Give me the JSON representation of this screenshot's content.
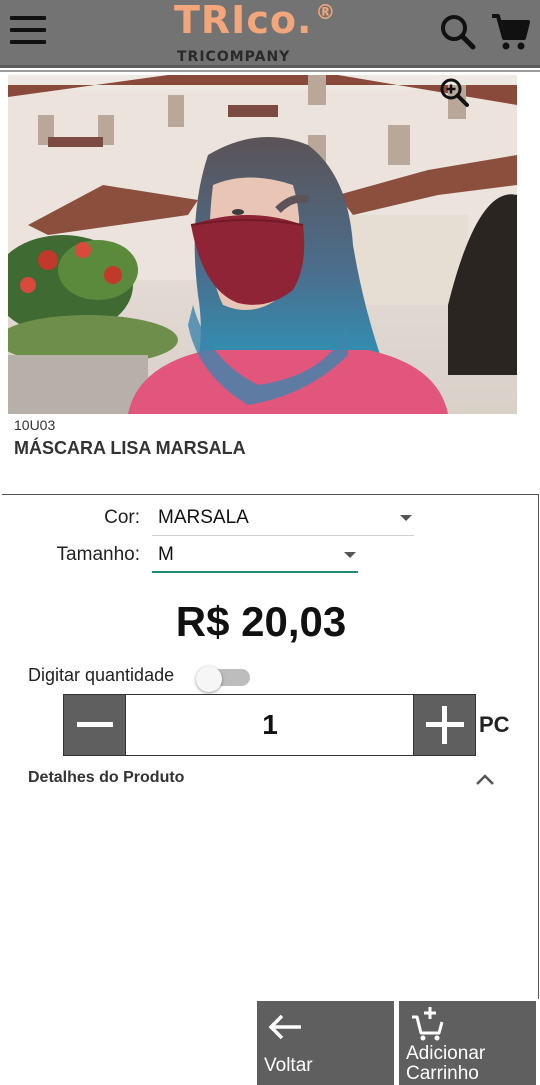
{
  "header": {
    "logo_text": "TRIco.",
    "logo_registered": "®",
    "logo_subtitle": "TRICOMPANY",
    "icons": [
      "menu-icon",
      "search-icon",
      "cart-icon"
    ]
  },
  "product": {
    "sku": "10U03",
    "name": "MÁSCARA LISA MARSALA",
    "zoom_icon": "zoom-in-icon"
  },
  "options": {
    "color_label": "Cor:",
    "color_value": "MARSALA",
    "size_label": "Tamanho:",
    "size_value": "M"
  },
  "price": "R$ 20,03",
  "quantity": {
    "toggle_label": "Digitar quantidade",
    "toggle_on": false,
    "value": "1",
    "unit": "PC"
  },
  "details": {
    "label": "Detalhes do Produto",
    "expanded": true
  },
  "actions": {
    "back_label": "Voltar",
    "add_label_line1": "Adicionar",
    "add_label_line2": "Carrinho"
  },
  "colors": {
    "header_bg": "#737373",
    "logo": "#f2a67a",
    "button_bg": "#5f5f5f",
    "accent": "#1f8a7a"
  }
}
